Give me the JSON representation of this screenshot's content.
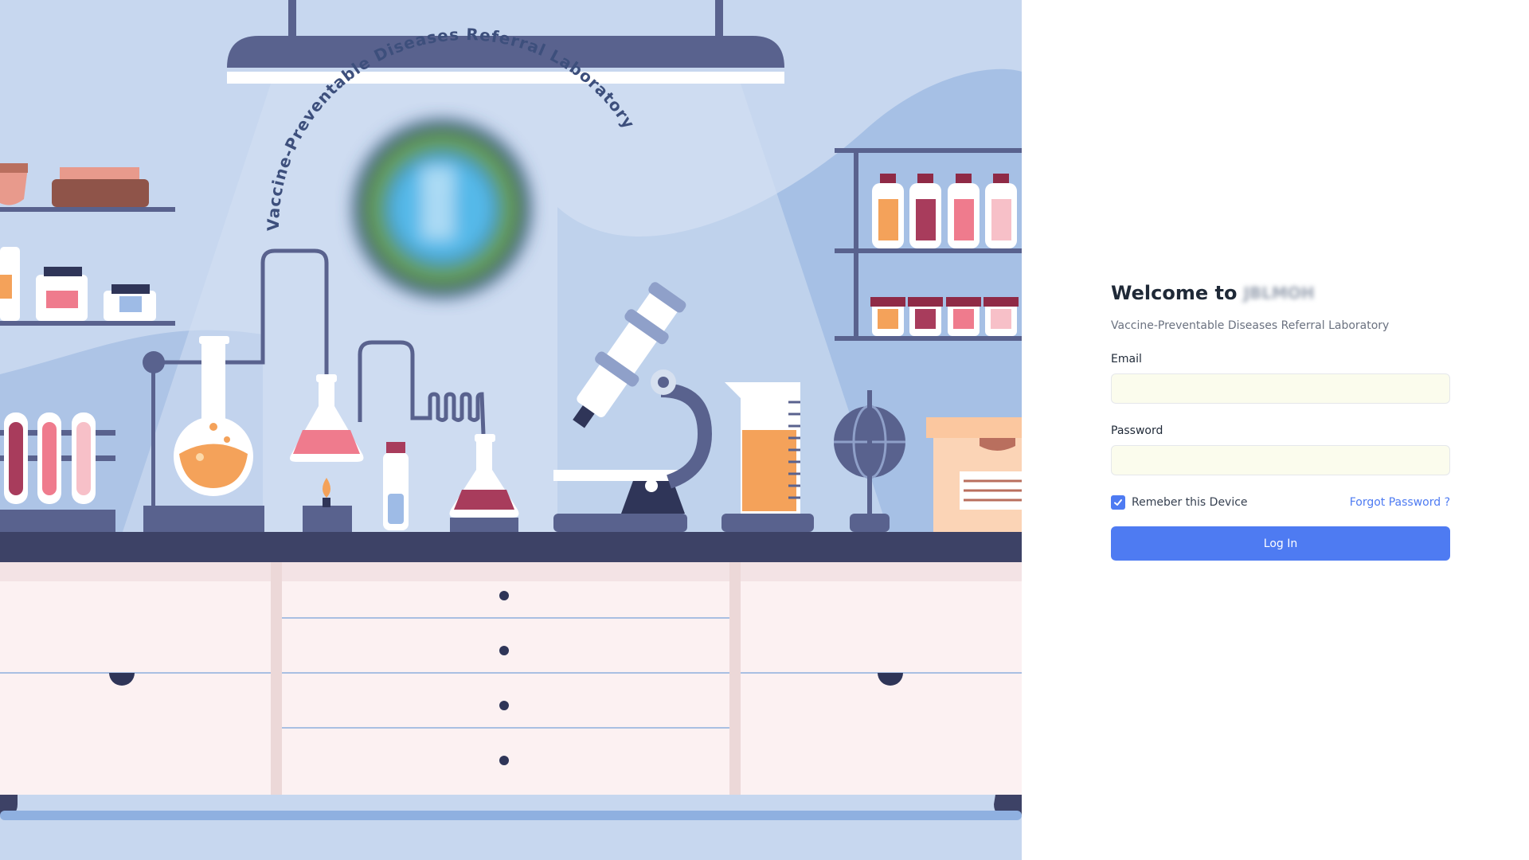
{
  "illustration": {
    "arc_title": "Vaccine-Preventable Diseases Referral Laboratory",
    "logo": "blurred-lab-logo"
  },
  "login": {
    "welcome_prefix": "Welcome to",
    "welcome_name": "JBLMOH",
    "subtitle": "Vaccine-Preventable Diseases Referral Laboratory",
    "email_label": "Email",
    "email_value": "",
    "password_label": "Password",
    "password_value": "",
    "remember_label": "Remeber this Device",
    "remember_checked": true,
    "forgot_label": "Forgot Password ?",
    "login_label": "Log In"
  },
  "colors": {
    "accent": "#4e7bf2",
    "input_bg": "#fbfced",
    "left_bg": "#c7d7ef"
  }
}
